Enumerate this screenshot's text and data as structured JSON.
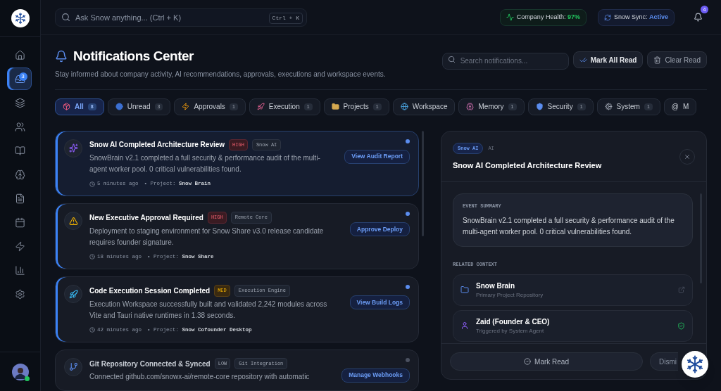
{
  "sidebar": {
    "items": [
      {
        "selected": false
      },
      {
        "selected": true,
        "badge": "3"
      },
      {
        "selected": false
      },
      {
        "selected": false
      },
      {
        "selected": false
      },
      {
        "selected": false
      },
      {
        "selected": false
      },
      {
        "selected": false
      },
      {
        "selected": false
      },
      {
        "selected": false
      },
      {
        "selected": false
      }
    ],
    "user": {
      "online": true
    }
  },
  "topbar": {
    "search": {
      "placeholder": "Ask Snow anything... (Ctrl + K)",
      "shortcut": "Ctrl + K"
    },
    "health": {
      "label": "Company Health:",
      "value": "97%"
    },
    "sync": {
      "label": "Snow Sync:",
      "value": "Active"
    },
    "bell_badge": "4"
  },
  "header": {
    "title": "Notifications Center",
    "subtitle": "Stay informed about company activity, AI recommendations, approvals, executions and workspace events.",
    "search": {
      "placeholder": "Search notifications..."
    },
    "buttons": [
      {
        "kind": "mark",
        "label": "Mark All Read"
      },
      {
        "kind": "clear",
        "label": "Clear Read"
      }
    ]
  },
  "tabs": [
    {
      "label": "All",
      "count": "8",
      "selected": true
    },
    {
      "label": "Unread",
      "count": "3",
      "selected": false
    },
    {
      "label": "Approvals",
      "count": "1",
      "selected": false
    },
    {
      "label": "Execution",
      "count": "1",
      "selected": false
    },
    {
      "label": "Projects",
      "count": "1",
      "selected": false
    },
    {
      "label": "Workspace",
      "selected": false
    },
    {
      "label": "Memory",
      "count": "1",
      "selected": false
    },
    {
      "label": "Security",
      "count": "1",
      "selected": false
    },
    {
      "label": "System",
      "count": "1",
      "selected": false
    },
    {
      "glyph": "@",
      "label": "M",
      "selected": false
    }
  ],
  "notifications": [
    {
      "title": "Snow AI Completed Architecture Review",
      "priority": "HIGH",
      "source": "Snow AI",
      "text": "SnowBrain v2.1 completed a full security & performance audit of the multi-agent worker pool. 0 critical vulnerabilities found.",
      "time": "5 minutes ago",
      "project_label": "• Project:",
      "project": "Snow Brain",
      "action": "View Audit Report",
      "unread": true,
      "selected": true
    },
    {
      "title": "New Executive Approval Required",
      "priority": "HIGH",
      "source": "Remote Core",
      "text": "Deployment to staging environment for Snow Share v3.0 release candidate requires founder signature.",
      "time": "18 minutes ago",
      "project_label": "• Project:",
      "project": "Snow Share",
      "action": "Approve Deploy",
      "unread": true,
      "selected": false
    },
    {
      "title": "Code Execution Session Completed",
      "priority": "MED",
      "source": "Execution Engine",
      "text": "Execution Workspace successfully built and validated 2,242 modules across Vite and Tauri native runtimes in 1.38 seconds.",
      "time": "42 minutes ago",
      "project_label": "• Project:",
      "project": "Snow Cofounder Desktop",
      "action": "View Build Logs",
      "unread": true,
      "selected": false
    },
    {
      "title": "Git Repository Connected & Synced",
      "priority": "LOW",
      "source": "Git Integration",
      "text": "Connected github.com/snowx-ai/remote-core repository with automatic",
      "action": "Manage Webhooks",
      "unread": false,
      "selected": false
    }
  ],
  "detail": {
    "tag": "Snow AI",
    "category": "AI",
    "title": "Snow AI Completed Architecture Review",
    "summary_label": "EVENT SUMMARY",
    "summary": "SnowBrain v2.1 completed a full security & performance audit of the multi-agent worker pool. 0 critical vulnerabilities found.",
    "context_label": "RELATED CONTEXT",
    "context": [
      {
        "kind": "project",
        "title": "Snow Brain",
        "subtitle": "Primary Project Repository"
      },
      {
        "kind": "person",
        "title": "Zaid (Founder & CEO)",
        "subtitle": "Triggered by System Agent"
      }
    ],
    "buttons": [
      {
        "kind": "read",
        "label": "Mark Read"
      },
      {
        "kind": "dismiss",
        "label": "Dismi"
      }
    ]
  }
}
